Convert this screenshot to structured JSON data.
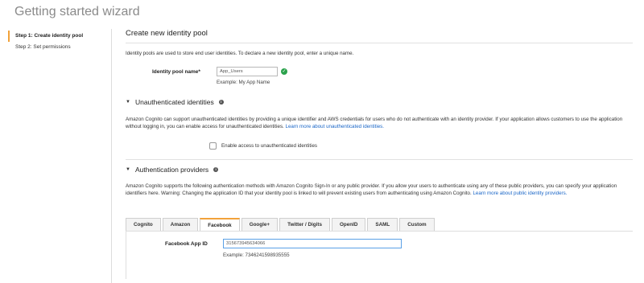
{
  "wizard_title": "Getting started wizard",
  "sidebar": {
    "steps": [
      {
        "label": "Step 1: Create identity pool"
      },
      {
        "label": "Step 2: Set permissions"
      }
    ]
  },
  "main": {
    "title": "Create new identity pool",
    "intro": "Identity pools are used to store end user identities. To declare a new identity pool, enter a unique name.",
    "pool_name": {
      "label": "Identity pool name*",
      "value": "App_Users",
      "example": "Example: My App Name"
    },
    "unauth": {
      "title": "Unauthenticated identities",
      "description": "Amazon Cognito can support unauthenticated identities by providing a unique identifier and AWS credentials for users who do not authenticate with an identity provider. If your application allows customers to use the application without logging in, you can enable access for unauthenticated identities.",
      "link": "Learn more about unauthenticated identities.",
      "checkbox_label": "Enable access to unauthenticated identities"
    },
    "auth": {
      "title": "Authentication providers",
      "description": "Amazon Cognito supports the following authentication methods with Amazon Cognito Sign-In or any public provider. If you allow your users to authenticate using any of these public providers, you can specify your application identifiers here. Warning: Changing the application ID that your identity pool is linked to will prevent existing users from authenticating using Amazon Cognito.",
      "link": "Learn more about public identity providers.",
      "tabs": [
        {
          "label": "Cognito"
        },
        {
          "label": "Amazon"
        },
        {
          "label": "Facebook"
        },
        {
          "label": "Google+"
        },
        {
          "label": "Twitter / Digits"
        },
        {
          "label": "OpenID"
        },
        {
          "label": "SAML"
        },
        {
          "label": "Custom"
        }
      ],
      "active_tab": "Facebook",
      "facebook": {
        "label": "Facebook App ID",
        "value": "315673945634066",
        "example": "Example: 7346241598935555"
      }
    }
  },
  "colors": {
    "accent": "#f2a23a",
    "link": "#1a66c7",
    "success": "#2ba24c"
  }
}
